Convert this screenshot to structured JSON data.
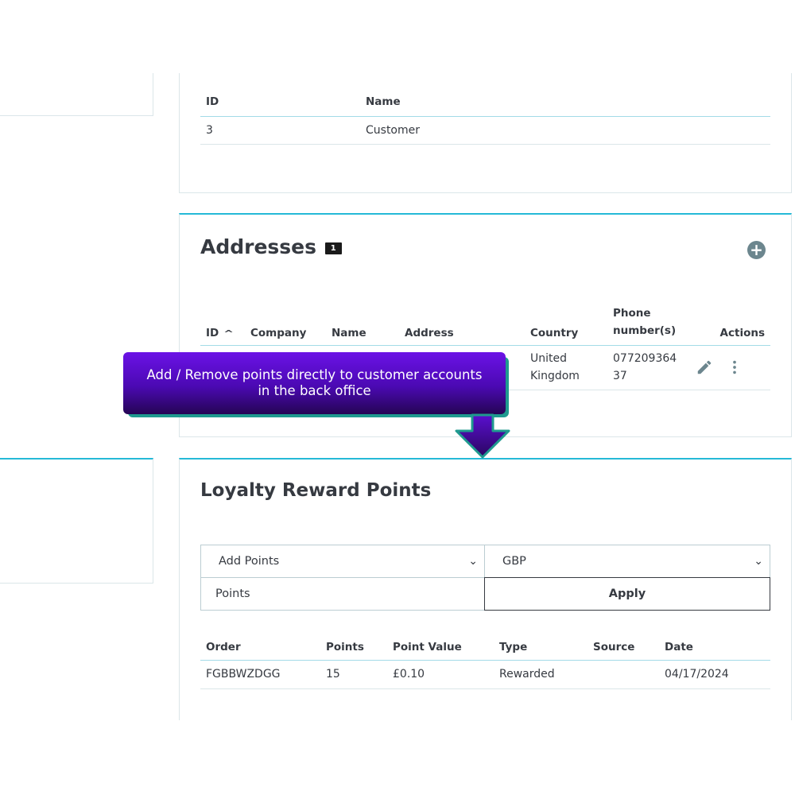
{
  "group_table": {
    "headers": [
      "ID",
      "Name"
    ],
    "rows": [
      [
        "3",
        "Customer"
      ]
    ]
  },
  "addresses": {
    "title": "Addresses",
    "count": "1",
    "add_icon": "plus-circle-icon",
    "headers": {
      "id": "ID",
      "company": "Company",
      "name": "Name",
      "address": "Address",
      "country": "Country",
      "phone": "Phone number(s)",
      "actions": "Actions"
    },
    "row": {
      "country": "United Kingdom",
      "phone": "07720936437"
    }
  },
  "callout": {
    "text_line1": "Add / Remove points directly to customer accounts",
    "text_line2": "in the back office",
    "colors": {
      "top": "#6b12e6",
      "bottom": "#250554",
      "outline": "#1f9a8f"
    }
  },
  "loyalty": {
    "title": "Loyalty Reward Points",
    "action_select": "Add Points",
    "currency_select": "GBP",
    "points_placeholder": "Points",
    "apply_label": "Apply",
    "headers": [
      "Order",
      "Points",
      "Point Value",
      "Type",
      "Source",
      "Date"
    ],
    "rows": [
      [
        "FGBBWZDGG",
        "15",
        "£0.10",
        "Rewarded",
        "",
        "04/17/2024"
      ]
    ]
  },
  "colors": {
    "accent": "#25b9d7",
    "text": "#363a41",
    "border": "#dbe6e9"
  }
}
